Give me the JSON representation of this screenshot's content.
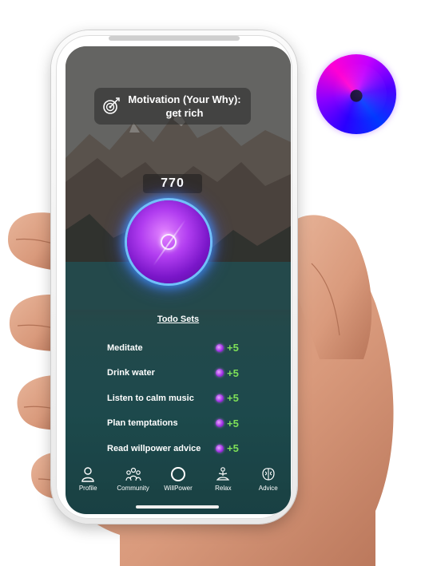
{
  "motivation": {
    "text": "Motivation (Your Why): get rich"
  },
  "score": {
    "value": "770"
  },
  "todo": {
    "heading": "Todo Sets",
    "items": [
      {
        "label": "Meditate",
        "reward": "+5"
      },
      {
        "label": "Drink water",
        "reward": "+5"
      },
      {
        "label": "Listen to calm music",
        "reward": "+5"
      },
      {
        "label": "Plan temptations",
        "reward": "+5"
      },
      {
        "label": "Read willpower advice",
        "reward": "+5"
      }
    ]
  },
  "tabs": [
    {
      "label": "Profile",
      "icon": "person-icon"
    },
    {
      "label": "Community",
      "icon": "people-icon"
    },
    {
      "label": "WillPower",
      "icon": "circle-icon"
    },
    {
      "label": "Relax",
      "icon": "meditation-icon"
    },
    {
      "label": "Advice",
      "icon": "brain-icon"
    }
  ],
  "colors": {
    "reward": "#7ee058",
    "orb": "#b13df0",
    "glow": "#3c96ff"
  }
}
